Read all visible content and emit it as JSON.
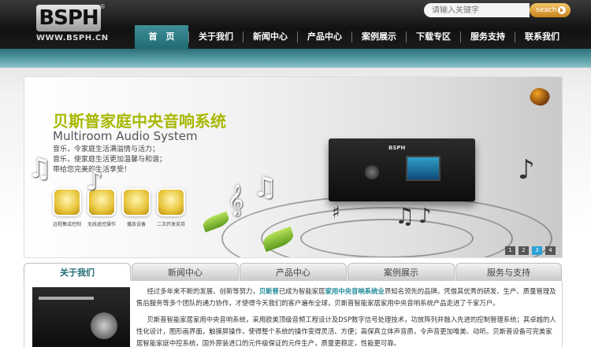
{
  "header": {
    "logo_text": "BSPH",
    "logo_mark": "®",
    "site_url": "WWW.BSPH.CN",
    "search_placeholder": "请输入关键字",
    "search_button": "seach"
  },
  "nav": {
    "items": [
      {
        "label": "首　页",
        "active": true
      },
      {
        "label": "关于我们",
        "active": false
      },
      {
        "label": "新闻中心",
        "active": false
      },
      {
        "label": "产品中心",
        "active": false
      },
      {
        "label": "案例展示",
        "active": false
      },
      {
        "label": "下载专区",
        "active": false
      },
      {
        "label": "服务支持",
        "active": false
      },
      {
        "label": "联系我们",
        "active": false
      }
    ]
  },
  "banner": {
    "title": "贝斯普家庭中央音响系统",
    "subtitle": "Multiroom Audio System",
    "lines": [
      "音乐，令家庭生活满溢情与活力；",
      "音乐，使家庭生活更加温馨与和谐；",
      "带给您完美的生活享受！"
    ],
    "feature_labels": [
      "远程集成控制",
      "无线遥控操作",
      "播放设备",
      "二次开发支持"
    ],
    "device_logo": "BSPH",
    "slides": [
      "1",
      "2",
      "3",
      "4"
    ],
    "active_slide": 3
  },
  "tabs": [
    {
      "label": "关于我们",
      "active": true
    },
    {
      "label": "新闻中心",
      "active": false
    },
    {
      "label": "产品中心",
      "active": false
    },
    {
      "label": "案例展示",
      "active": false
    },
    {
      "label": "服务与支持",
      "active": false
    }
  ],
  "about": {
    "p1_a": "经过多年来不断的发展、创新等努力，",
    "p1_brand": "贝斯普",
    "p1_b": "已成为智能家居",
    "p1_hl": "家用中央音响系统业",
    "p1_c": "界知名领先的品牌。凭借其优秀的研发、生产、质量管理及售后服务等多个团队的通力协作，才使得今天我们的客户遍布全球，贝斯普智能家居家用中央音响系统产品走进了千家万户。",
    "p2": "贝斯普智能家居家用中央音响系统，采用欧美顶级音频工程设计及DSP数字信号处理技术，功放阵列并融入先进的控制管理系统；其卓越的人性化设计，图形画界面，触摸屏操作，使得整个系统的操作变得灵活、方便；高保真立体声音质，令声音更加唯美、动听。贝斯普设备可完美家居智能家庭中控系统，国外原装进口的元件级保证的元件生产，质量更稳定，性能更可靠。"
  },
  "colors": {
    "nav_active": "#2f7e88",
    "teal_band": "#5aa1a8",
    "banner_title": "#a8b800",
    "highlight": "#1f8a9a",
    "search_button": "#d99a2b"
  }
}
